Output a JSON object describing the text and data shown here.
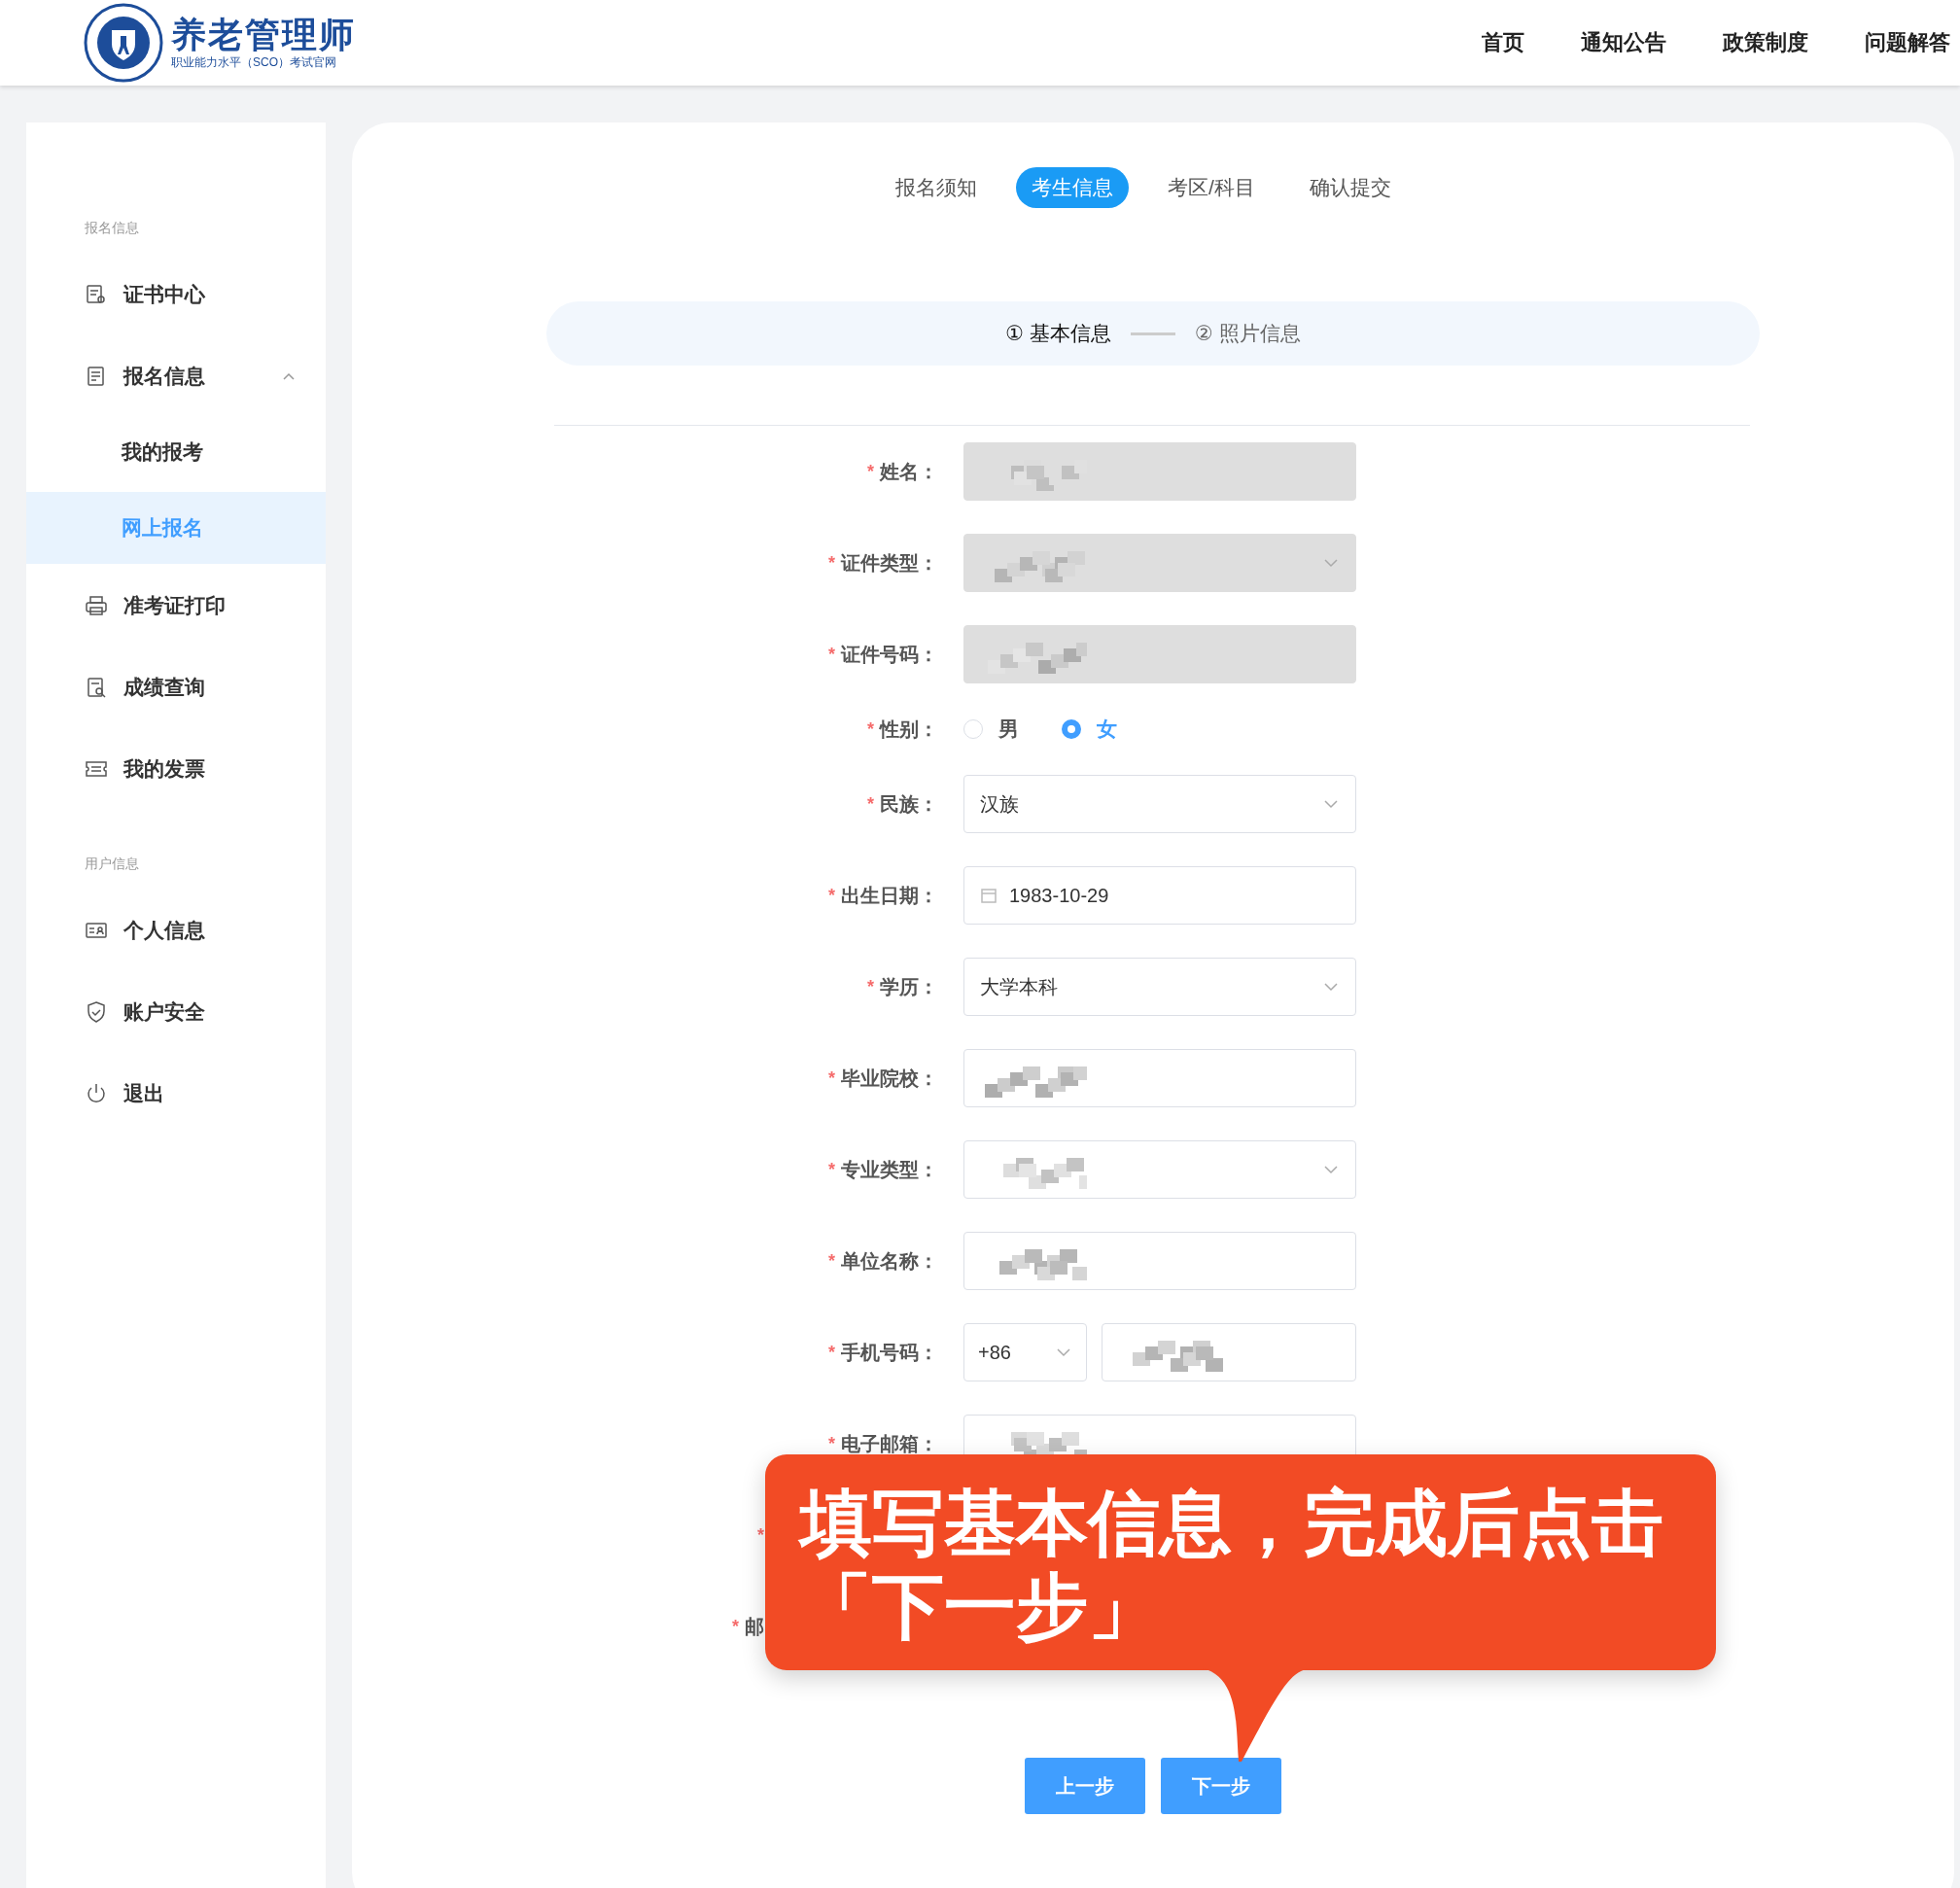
{
  "header": {
    "logo": {
      "title": "养老管理师",
      "subtitle": "职业能力水平（SCO）考试官网"
    },
    "nav": [
      {
        "label": "首页"
      },
      {
        "label": "通知公告"
      },
      {
        "label": "政策制度"
      },
      {
        "label": "问题解答"
      }
    ]
  },
  "sidebar": {
    "sections": [
      {
        "title": "报名信息",
        "items": [
          {
            "label": "证书中心",
            "kind": "certificate"
          },
          {
            "label": "报名信息",
            "kind": "document",
            "expanded": true,
            "children": [
              {
                "label": "我的报考",
                "selected": false
              },
              {
                "label": "网上报名",
                "selected": true
              }
            ]
          },
          {
            "label": "准考证打印",
            "kind": "printer"
          },
          {
            "label": "成绩查询",
            "kind": "search-doc"
          },
          {
            "label": "我的发票",
            "kind": "ticket"
          }
        ]
      },
      {
        "title": "用户信息",
        "items": [
          {
            "label": "个人信息",
            "kind": "id-card"
          },
          {
            "label": "账户安全",
            "kind": "shield"
          },
          {
            "label": "退出",
            "kind": "power"
          }
        ]
      }
    ]
  },
  "main": {
    "tabs": [
      {
        "label": "报名须知",
        "selected": false
      },
      {
        "label": "考生信息",
        "selected": true
      },
      {
        "label": "考区/科目",
        "selected": false
      },
      {
        "label": "确认提交",
        "selected": false
      }
    ],
    "steps": [
      {
        "label": "① 基本信息",
        "selected": true
      },
      {
        "label": "② 照片信息",
        "selected": false
      }
    ],
    "form": {
      "rows": [
        {
          "label": "姓名：",
          "kind": "input",
          "marker": "*",
          "disabled": true,
          "masked": true
        },
        {
          "label": "证件类型：",
          "kind": "select",
          "marker": "*",
          "disabled": true,
          "masked": true
        },
        {
          "label": "证件号码：",
          "kind": "input",
          "marker": "*",
          "disabled": true,
          "masked": true
        },
        {
          "label": "性别：",
          "kind": "radio",
          "marker": "*",
          "options": [
            {
              "label": "男",
              "selected": false
            },
            {
              "label": "女",
              "selected": true
            }
          ]
        },
        {
          "label": "民族：",
          "kind": "select",
          "marker": "*",
          "disabled": false,
          "masked": false,
          "value": "汉族"
        },
        {
          "label": "出生日期：",
          "kind": "date",
          "marker": "*",
          "value": "1983-10-29"
        },
        {
          "label": "学历：",
          "kind": "select",
          "marker": "*",
          "disabled": false,
          "masked": false,
          "value": "大学本科"
        },
        {
          "label": "毕业院校：",
          "kind": "input",
          "marker": "*",
          "disabled": false,
          "masked": true
        },
        {
          "label": "专业类型：",
          "kind": "select",
          "marker": "*",
          "disabled": false,
          "masked": true
        },
        {
          "label": "单位名称：",
          "kind": "input",
          "marker": "*",
          "disabled": false,
          "masked": true
        },
        {
          "label": "手机号码：",
          "kind": "phone",
          "marker": "*",
          "prefix": "+86",
          "masked": true
        },
        {
          "label": "电子邮箱：",
          "kind": "input",
          "marker": "*",
          "disabled": false,
          "masked": true
        },
        {
          "kind": "covered",
          "marker": "*"
        },
        {
          "kind": "covered",
          "marker": "*",
          "label": "邮"
        }
      ]
    },
    "callout": {
      "text": "填写基本信息，完成后点击「下一步」"
    },
    "buttons": [
      {
        "label": "上一步"
      },
      {
        "label": "下一步"
      }
    ]
  }
}
